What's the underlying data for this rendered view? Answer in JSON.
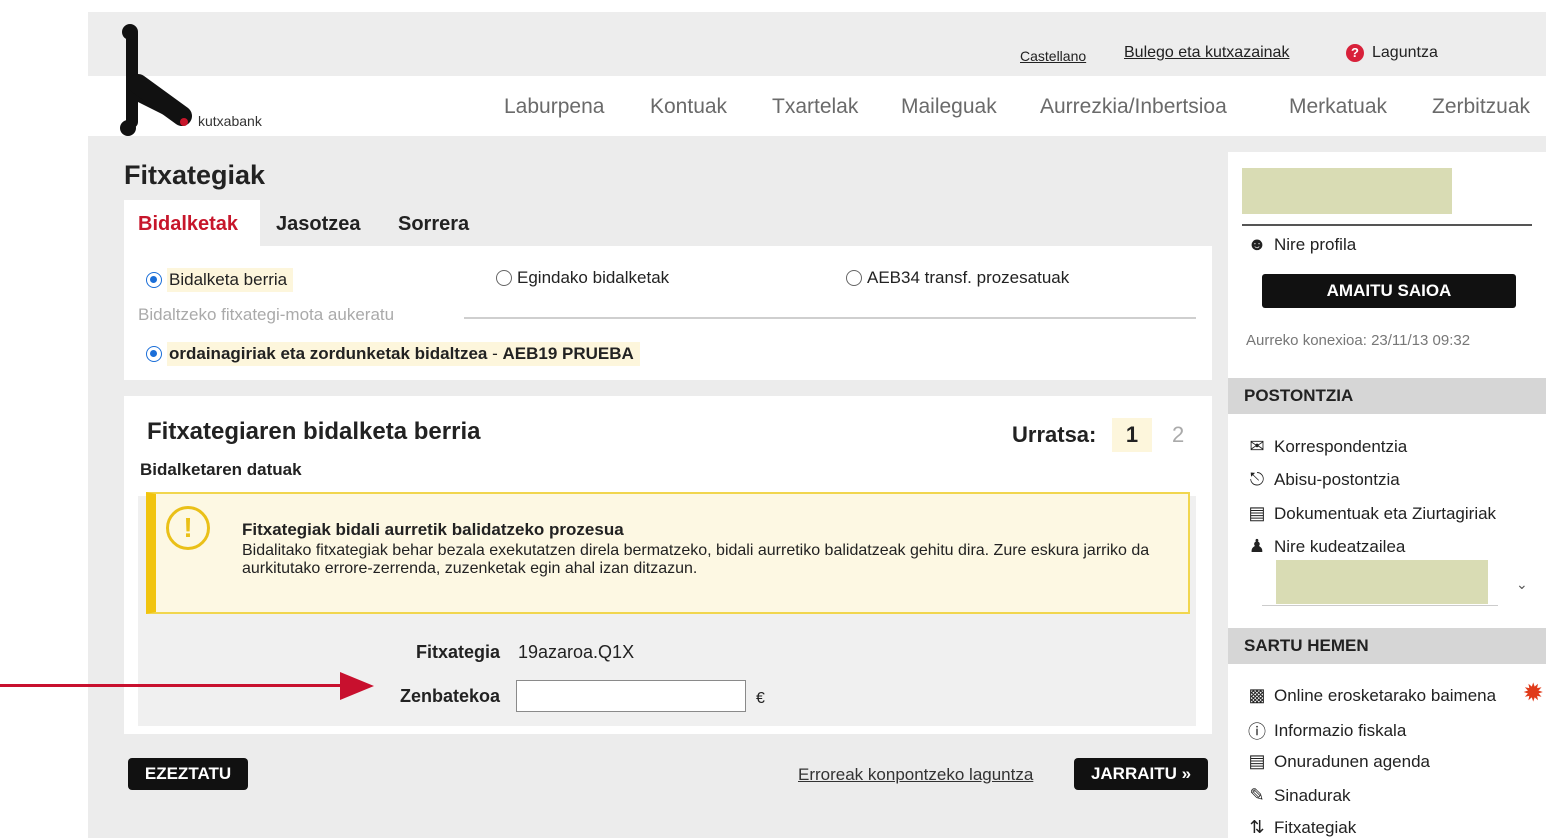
{
  "header": {
    "logo_text": "kutxabank",
    "links": {
      "language": "Castellano",
      "offices": "Bulego eta kutxazainak",
      "help": "Laguntza",
      "help_glyph": "?"
    },
    "nav": [
      "Laburpena",
      "Kontuak",
      "Txartelak",
      "Maileguak",
      "Aurrezkia/Inbertsioa",
      "Merkatuak",
      "Zerbitzuak"
    ]
  },
  "page": {
    "title": "Fitxategiak",
    "tabs": [
      "Bidalketak",
      "Jasotzea",
      "Sorrera"
    ],
    "radios_top": [
      {
        "label": "Bidalketa berria",
        "checked": true
      },
      {
        "label": "Egindako bidalketak",
        "checked": false
      },
      {
        "label": "AEB34 transf. prozesatuak",
        "checked": false
      }
    ],
    "file_type_legend": "Bidaltzeko fitxategi-mota aukeratu",
    "file_type_option": {
      "label_main": "ordainagiriak eta zordunketak bidaltzea",
      "label_sep": " - ",
      "label_code": "AEB19 PRUEBA",
      "checked": true
    }
  },
  "wizard": {
    "title": "Fitxategiaren bidalketa berria",
    "step_label": "Urratsa:",
    "step_current": "1",
    "step_next": "2",
    "subtitle": "Bidalketaren datuak",
    "warning": {
      "icon_glyph": "!",
      "title": "Fitxategiak bidali aurretik balidatzeko prozesua",
      "body": "Bidalitako fitxategiak behar bezala exekutatzen direla bermatzeko, bidali aurretiko balidatzeak gehitu dira. Zure eskura jarriko da aurkitutako errore-zerrenda, zuzenketak egin ahal izan ditzazun."
    },
    "file_label": "Fitxategia",
    "file_value": "19azaroa.Q1X",
    "amount_label": "Zenbatekoa",
    "amount_value": "",
    "currency": "€"
  },
  "actions": {
    "cancel": "EZEZTATU",
    "help_link": "Erroreak konpontzeko laguntza",
    "continue": "JARRAITU »"
  },
  "sidebar": {
    "profile": "Nire profila",
    "logout": "AMAITU SAIOA",
    "last_connection": "Aurreko konexioa: 23/11/13 09:32",
    "mailbox_header": "POSTONTZIA",
    "mailbox_items": [
      {
        "icon": "envelope-icon",
        "label": "Korrespondentzia"
      },
      {
        "icon": "bell-icon",
        "label": "Abisu-postontzia"
      },
      {
        "icon": "documents-icon",
        "label": "Dokumentuak eta Ziurtagiriak"
      },
      {
        "icon": "manager-icon",
        "label": "Nire kudeatzailea"
      }
    ],
    "access_header": "SARTU HEMEN",
    "access_items": [
      {
        "icon": "card-icon",
        "label": "Online erosketarako baimena"
      },
      {
        "icon": "info-person-icon",
        "label": "Informazio fiskala"
      },
      {
        "icon": "agenda-icon",
        "label": "Onuradunen agenda"
      },
      {
        "icon": "signature-icon",
        "label": "Sinadurak"
      },
      {
        "icon": "transfer-arrows-icon",
        "label": "Fitxategiak"
      }
    ]
  },
  "colors": {
    "brand_red": "#c7162b",
    "highlight": "#fdf6dc",
    "warning_border": "#f1c40f",
    "placeholder_green": "#d9dcb4",
    "annotation_arrow": "#c8102e"
  }
}
